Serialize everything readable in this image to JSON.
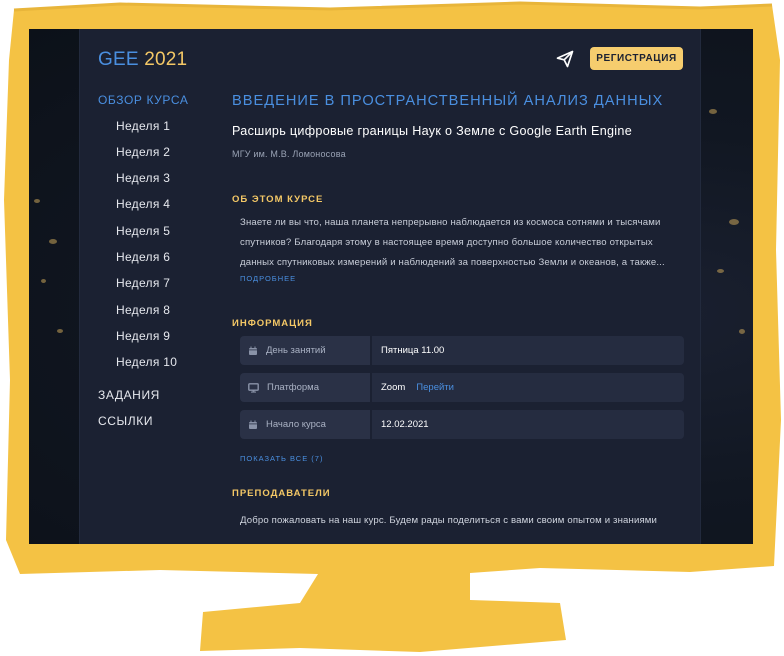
{
  "colors": {
    "frame": "#f4c244",
    "accent": "#4a8fe0",
    "gold": "#f4c866",
    "panel": "#1b2132"
  },
  "header": {
    "logo_gee": "GEE",
    "logo_year": "2021",
    "register_label": "РЕГИСТРАЦИЯ",
    "icon": "telegram-send-icon"
  },
  "sidebar": {
    "course_overview": "ОБЗОР КУРСА",
    "weeks": [
      "Неделя 1",
      "Неделя 2",
      "Неделя 3",
      "Неделя 4",
      "Неделя 5",
      "Неделя 6",
      "Неделя 7",
      "Неделя 8",
      "Неделя 9",
      "Неделя 10"
    ],
    "tasks": "ЗАДАНИЯ",
    "links": "ССЫЛКИ"
  },
  "course": {
    "title": "ВВЕДЕНИЕ В ПРОСТРАНСТВЕННЫЙ АНАЛИЗ ДАННЫХ",
    "subtitle": "Расширь цифровые границы Наук о Земле с Google Earth Engine",
    "university": "МГУ им. М.В. Ломоносова"
  },
  "about": {
    "heading": "ОБ ЭТОМ КУРСЕ",
    "text_lines": [
      "Знаете ли вы что, наша планета непрерывно наблюдается из космоса сотнями и тысячами",
      "спутников? Благодаря этому в настоящее время доступно большое количество открытых",
      "данных спутниковых измерений и наблюдений за поверхностью Земли и океанов, а также..."
    ],
    "more_link": "ПОДРОБНЕЕ"
  },
  "info": {
    "heading": "ИНФОРМАЦИЯ",
    "rows": [
      {
        "label": "День занятий",
        "value": "Пятница 11.00",
        "icon": "calendar-icon"
      },
      {
        "label": "Платформа",
        "value": "Zoom",
        "link": "Перейти",
        "icon": "monitor-icon"
      },
      {
        "label": "Начало курса",
        "value": "12.02.2021",
        "icon": "calendar-icon"
      }
    ],
    "show_all": "ПОКАЗАТЬ ВСЕ (7)"
  },
  "teachers": {
    "heading": "ПРЕПОДАВАТЕЛИ",
    "text": "Добро пожаловать на наш курс. Будем рады поделиться с вами своим опытом и знаниями"
  }
}
